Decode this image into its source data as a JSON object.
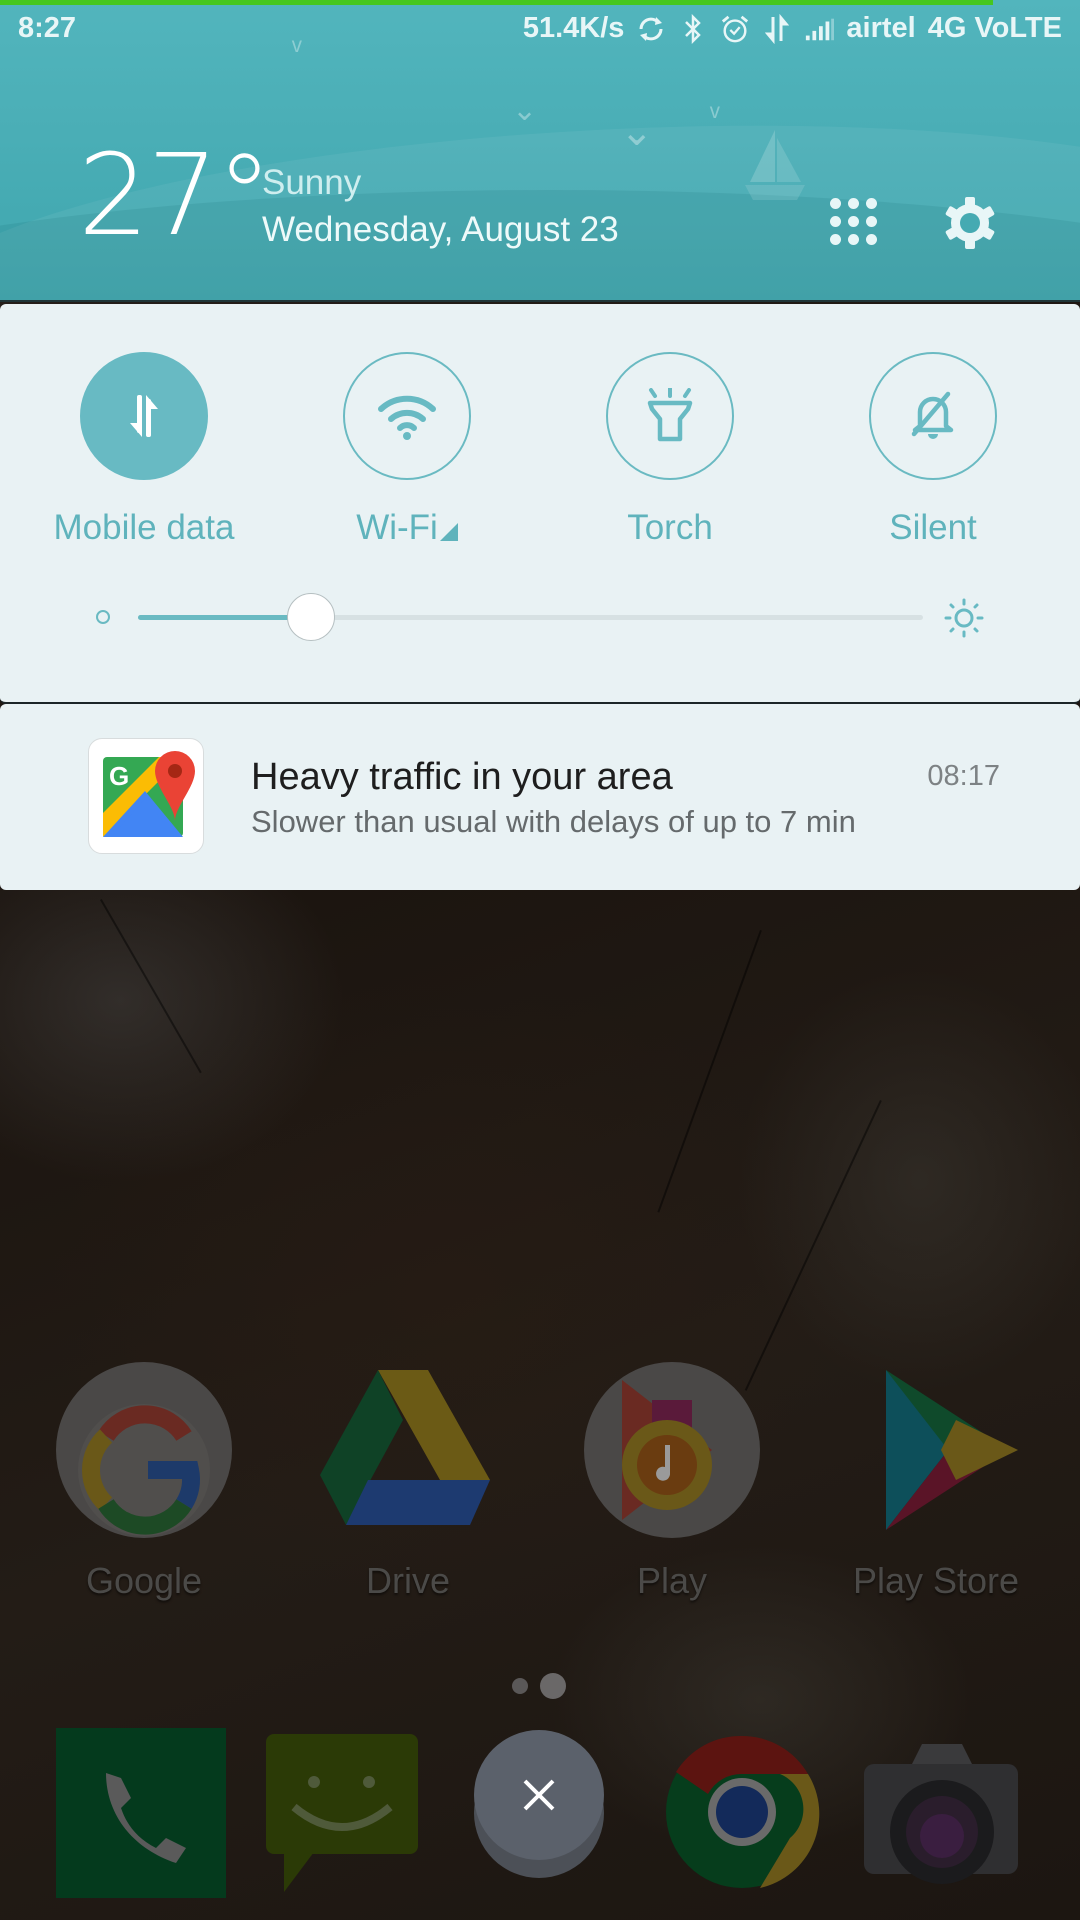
{
  "status_bar": {
    "time": "8:27",
    "network_speed": "51.4K/s",
    "icons": [
      "sync-icon",
      "bluetooth-icon",
      "alarm-icon",
      "data-transfer-icon",
      "signal-icon"
    ],
    "carrier": "airtel",
    "network_type": "4G VoLTE"
  },
  "weather": {
    "temperature": "27°",
    "condition": "Sunny",
    "date": "Wednesday, August 23"
  },
  "header_actions": {
    "all_toggles_icon": "grid-icon",
    "settings_icon": "gear-icon"
  },
  "quick_settings": {
    "toggles": [
      {
        "label": "Mobile data",
        "icon": "mobile-data-icon",
        "active": true
      },
      {
        "label": "Wi-Fi",
        "icon": "wifi-icon",
        "active": false,
        "has_dropdown": true
      },
      {
        "label": "Torch",
        "icon": "torch-icon",
        "active": false
      },
      {
        "label": "Silent",
        "icon": "bell-off-icon",
        "active": false
      }
    ],
    "brightness": {
      "level_percent": 22
    }
  },
  "notification": {
    "app": "Google Maps",
    "title": "Heavy traffic in your area",
    "body": "Slower than usual with delays of up to 7 min",
    "time": "08:17"
  },
  "home_screen": {
    "apps": [
      {
        "label": "Google"
      },
      {
        "label": "Drive"
      },
      {
        "label": "Play"
      },
      {
        "label": "Play Store"
      }
    ],
    "page_indicator": {
      "pages": 2,
      "current": 2
    },
    "dock": [
      "Phone",
      "Messaging",
      "Chrome",
      "Camera"
    ],
    "close_button_icon": "close-icon"
  },
  "colors": {
    "accent": "#68bac3",
    "header": "#4aaeb6",
    "panel": "#e9f2f4",
    "progress": "#46c71f"
  }
}
